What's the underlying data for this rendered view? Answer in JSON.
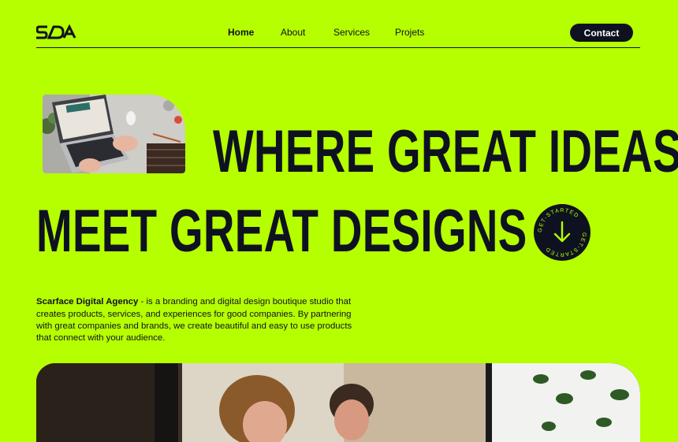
{
  "nav": {
    "logo": "SDA",
    "links": [
      {
        "label": "Home",
        "active": true
      },
      {
        "label": "About"
      },
      {
        "label": "Services"
      },
      {
        "label": "Projets"
      }
    ],
    "contact_label": "Contact"
  },
  "hero": {
    "line1": "WHERE GREAT IDEAS",
    "line2": "MEET GREAT DESIGNS",
    "badge_text": "GET-STARTED",
    "desc_strong": "Scarface Digital Agency",
    "desc_rest": " - is a branding and digital design boutique studio that creates products, services, and experiences for good companies. By partnering with great companies and brands, we create beautiful and easy to use products that connect with your audience."
  },
  "colors": {
    "background": "#b6ff00",
    "ink": "#0e1220",
    "button_text": "#ffffff"
  }
}
